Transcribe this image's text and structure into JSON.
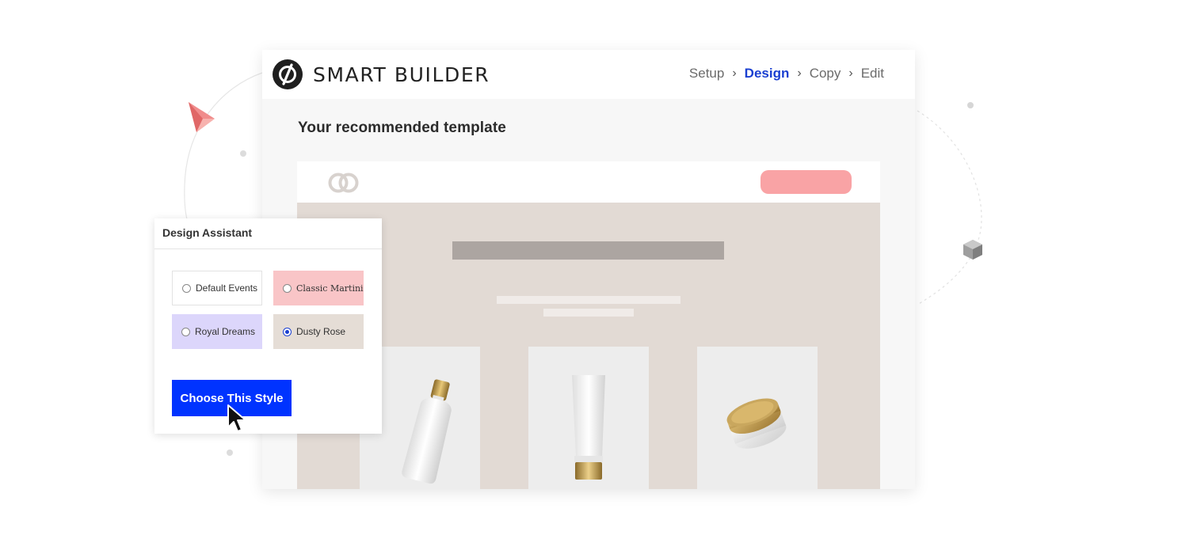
{
  "header": {
    "brand": "SMART BUILDER",
    "steps": [
      "Setup",
      "Design",
      "Copy",
      "Edit"
    ],
    "active_step": "Design"
  },
  "main": {
    "title": "Your recommended template"
  },
  "assistant": {
    "title": "Design Assistant",
    "options": [
      {
        "label": "Default Events",
        "selected": false,
        "color": "#ffffff"
      },
      {
        "label": "Classic Martini",
        "selected": false,
        "color": "#f9c5c7"
      },
      {
        "label": "Royal Dreams",
        "selected": false,
        "color": "#dcd6fb"
      },
      {
        "label": "Dusty Rose",
        "selected": true,
        "color": "#e5ddd6"
      }
    ],
    "choose_label": "Choose This Style"
  },
  "colors": {
    "accent": "#0033ff",
    "active_step": "#1a3fd1",
    "cta_pink": "#f9a3a5",
    "preview_bg": "#e2dad4"
  },
  "icons": [
    "logo-icon",
    "chevron-right-icon",
    "rings-logo-icon",
    "cursor-arrow-icon",
    "radio-icon"
  ]
}
